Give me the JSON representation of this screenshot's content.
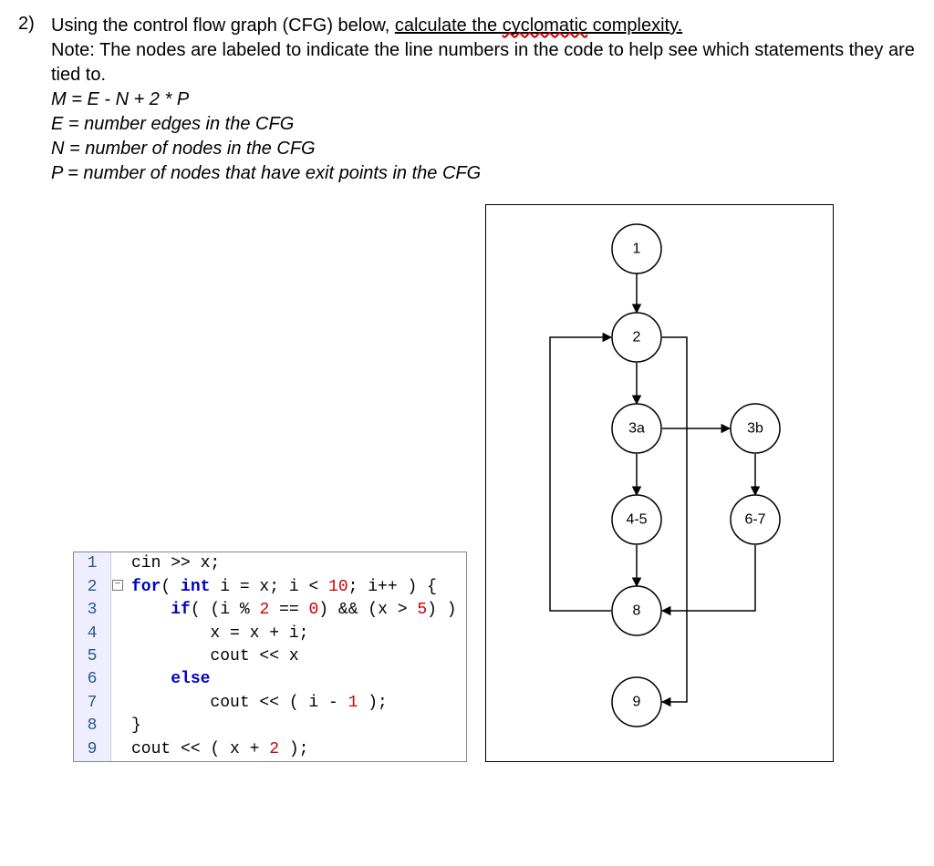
{
  "question": {
    "number": "2)",
    "line1_a": "Using the control flow graph (CFG) below, ",
    "line1_b": "calculate the ",
    "line1_c": "cyclomatic",
    "line1_d": " complexity.",
    "line2": "Note: The nodes are labeled to indicate the line numbers in the code to help see which statements they are tied to.",
    "formula": "M = E - N + 2 * P",
    "defE": "E = number edges in the CFG",
    "defN": "N = number of nodes in the CFG",
    "defP": "P = number of nodes that have exit points in the CFG"
  },
  "code": {
    "lines": [
      {
        "n": "1",
        "txt": "cin >> x;"
      },
      {
        "n": "2",
        "txt": "for( int i = x; i < 10; i++ ) {"
      },
      {
        "n": "3",
        "txt": "    if( (i % 2 == 0) && (x > 5) )"
      },
      {
        "n": "4",
        "txt": "        x = x + i;"
      },
      {
        "n": "5",
        "txt": "        cout << x"
      },
      {
        "n": "6",
        "txt": "    else"
      },
      {
        "n": "7",
        "txt": "        cout << ( i - 1 );"
      },
      {
        "n": "8",
        "txt": "}"
      },
      {
        "n": "9",
        "txt": "cout << ( x + 2 );"
      }
    ]
  },
  "nodes": {
    "n1": "1",
    "n2": "2",
    "n3a": "3a",
    "n3b": "3b",
    "n45": "4-5",
    "n67": "6-7",
    "n8": "8",
    "n9": "9"
  },
  "chart_data": {
    "type": "diagram",
    "title": "Control Flow Graph",
    "nodes": [
      "1",
      "2",
      "3a",
      "3b",
      "4-5",
      "6-7",
      "8",
      "9"
    ],
    "edges": [
      [
        "1",
        "2"
      ],
      [
        "2",
        "3a"
      ],
      [
        "3a",
        "3b"
      ],
      [
        "3a",
        "4-5"
      ],
      [
        "3b",
        "6-7"
      ],
      [
        "4-5",
        "8"
      ],
      [
        "6-7",
        "8"
      ],
      [
        "8",
        "2"
      ],
      [
        "2",
        "9"
      ]
    ],
    "N": 8,
    "E": 9,
    "P": 1
  }
}
